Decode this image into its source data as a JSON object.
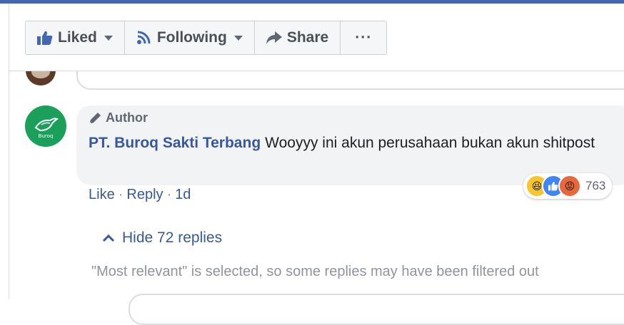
{
  "header": {
    "liked_label": "Liked",
    "following_label": "Following",
    "share_label": "Share",
    "more_label": "···"
  },
  "comment": {
    "badge": "Author",
    "author": "PT. Buroq Sakti Terbang",
    "text": "Wooyyy ini akun perusahaan bukan akun shitpost",
    "reaction_count": "763",
    "reactions": [
      "haha",
      "like",
      "angry"
    ],
    "like_action": "Like",
    "reply_action": "Reply",
    "time": "1d",
    "avatar_text": "Buroq"
  },
  "replies": {
    "toggle_label": "Hide 72 replies"
  },
  "filter_note": "\"Most relevant\" is selected, so some replies may have been filtered out",
  "colors": {
    "brand": "#4267b2",
    "link": "#385898",
    "bubble": "#f2f3f5",
    "avatar": "#1aa05a"
  }
}
